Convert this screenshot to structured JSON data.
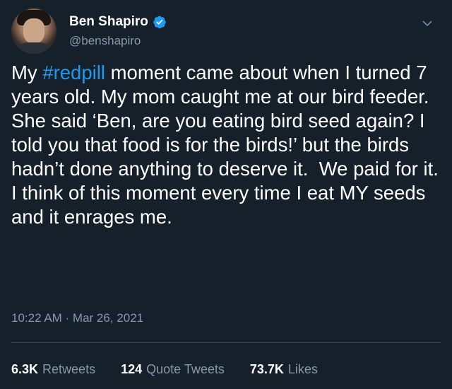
{
  "user": {
    "name": "Ben Shapiro",
    "handle": "@benshapiro",
    "verified_icon": "verified-badge-icon"
  },
  "tweet": {
    "text_before": "My ",
    "hashtag": "#redpill",
    "text_after": " moment came about when I turned 7 years old. My mom caught me at our bird feeder.  She said ‘Ben, are you eating bird seed again? I told you that food is for the birds!’ but the birds hadn’t done anything to deserve it.  We paid for it. I think of this moment every time I eat MY seeds and it enrages me.",
    "timestamp": "10:22 AM · Mar 26, 2021"
  },
  "stats": {
    "retweets_count": "6.3K",
    "retweets_label": "Retweets",
    "quote_tweets_count": "124",
    "quote_tweets_label": "Quote Tweets",
    "likes_count": "73.7K",
    "likes_label": "Likes"
  },
  "colors": {
    "background": "#15202b",
    "hashtag": "#1d9bf0",
    "verified": "#1d9bf0",
    "secondary_text": "#8899a6"
  }
}
